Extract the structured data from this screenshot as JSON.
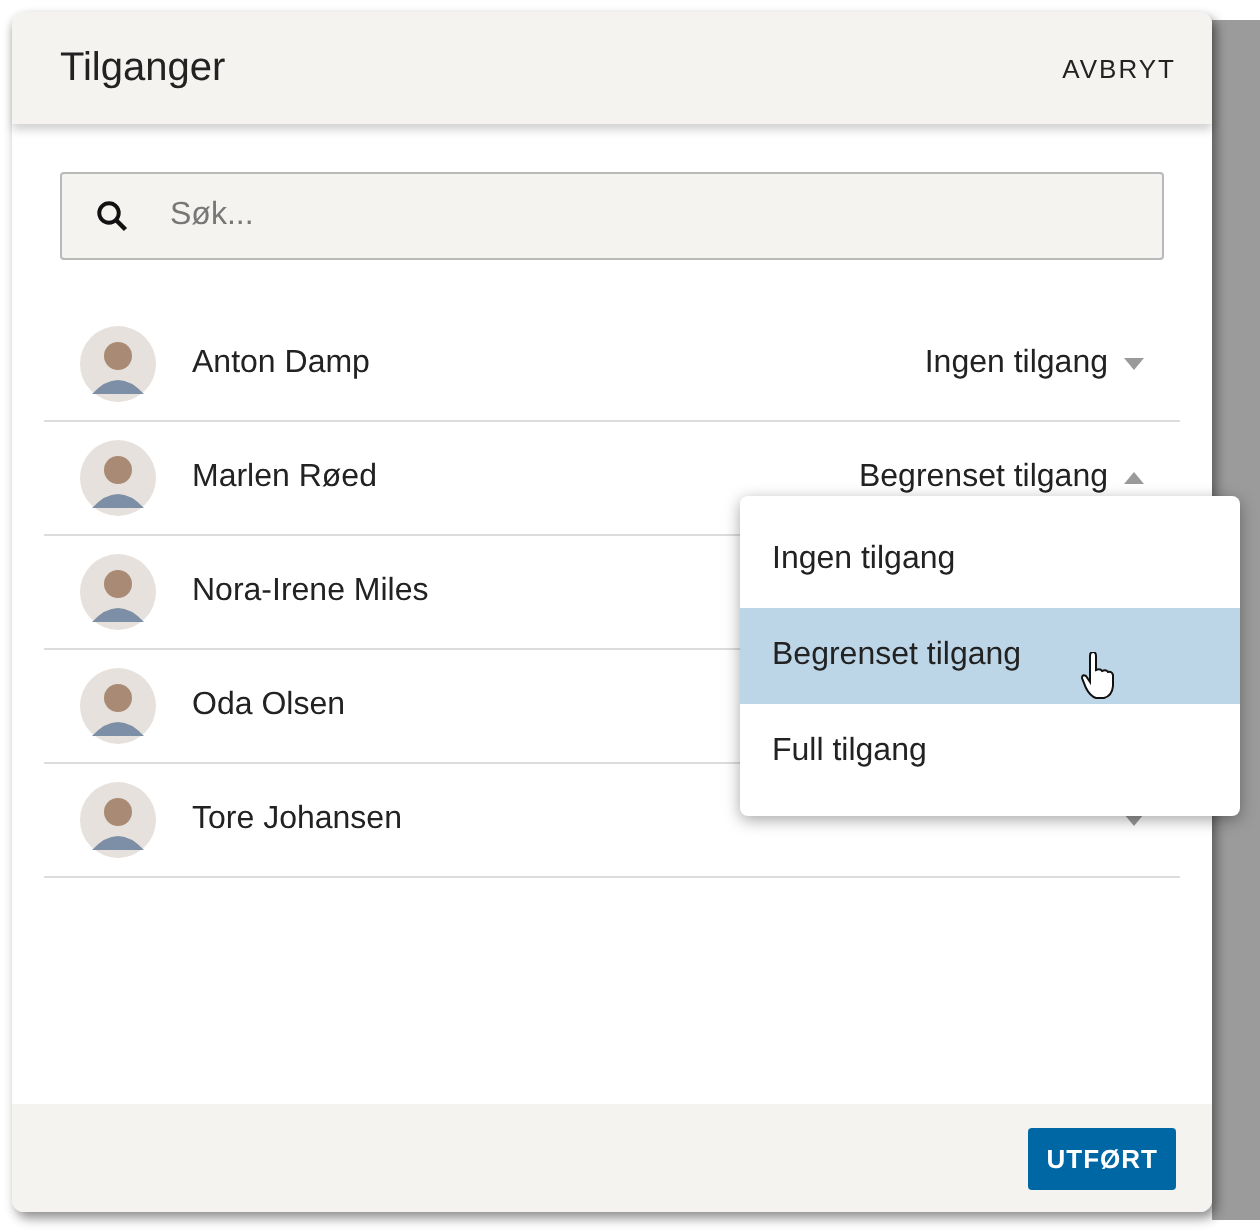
{
  "dialog": {
    "title": "Tilganger",
    "cancel": "AVBRYT",
    "search": {
      "placeholder": "Søk..."
    },
    "people": [
      {
        "name": "Anton Damp",
        "access": "Ingen tilgang",
        "expanded": false
      },
      {
        "name": "Marlen Røed",
        "access": "Begrenset tilgang",
        "expanded": true
      },
      {
        "name": "Nora-Irene Miles"
      },
      {
        "name": "Oda Olsen"
      },
      {
        "name": "Tore Johansen",
        "expanded": false
      }
    ],
    "menu": [
      {
        "label": "Ingen tilgang",
        "selected": false
      },
      {
        "label": "Begrenset tilgang",
        "selected": true
      },
      {
        "label": "Full tilgang",
        "selected": false
      }
    ],
    "done": "UTFØRT"
  }
}
